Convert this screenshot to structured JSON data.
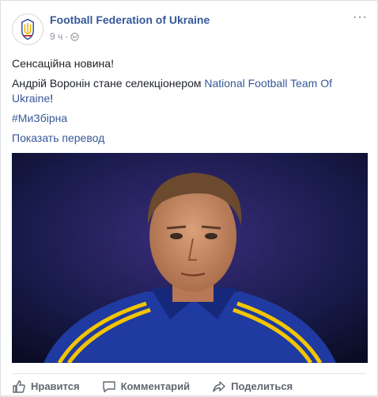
{
  "post": {
    "page_name": "Football Federation of Ukraine",
    "time": "9 ч",
    "separator": "·",
    "more_label": "···",
    "line1": "Сенсаційна новина!",
    "line2_prefix": "Андрій Воронін стане селекціонером ",
    "line2_link": "National Football Team Of Ukraine",
    "line2_suffix": "!",
    "hashtag": "#МиЗбірна",
    "translate_link": "Показать перевод",
    "photo_icon": "portrait-photo"
  },
  "actions": {
    "like": "Нравится",
    "comment": "Комментарий",
    "share": "Поделиться"
  },
  "colors": {
    "link": "#365899",
    "meta": "#90949c",
    "action": "#606770",
    "kit_blue": "#1f3aa0",
    "kit_yellow": "#f2c500"
  }
}
